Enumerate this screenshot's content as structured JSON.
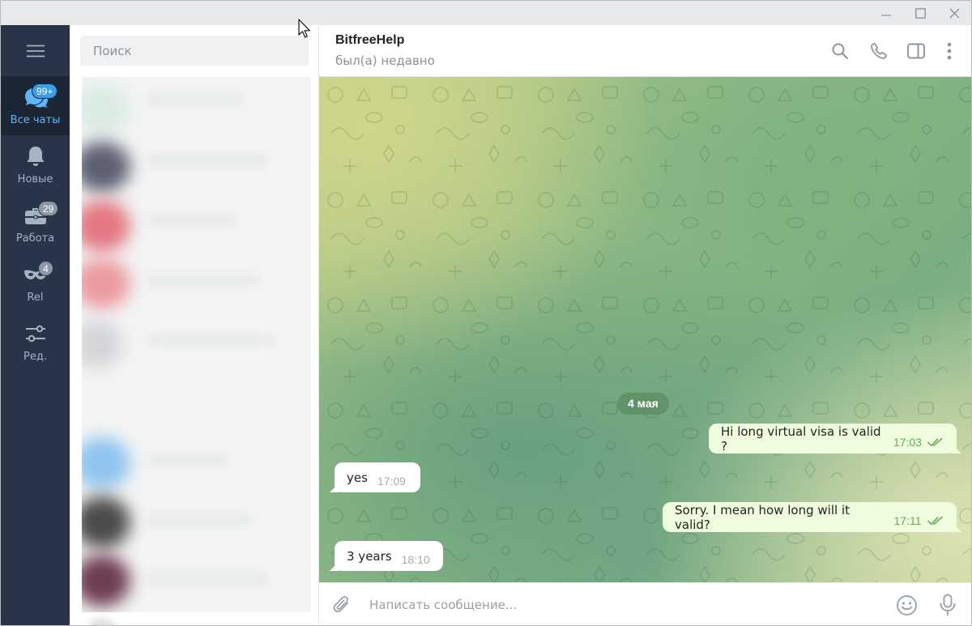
{
  "window": {
    "controls": [
      "minimize-icon",
      "maximize-icon",
      "close-icon"
    ]
  },
  "sidebar": {
    "menu_icon": "hamburger-icon",
    "folders": [
      {
        "label": "Все чаты",
        "badge": "99+",
        "icon": "chats-icon",
        "active": true
      },
      {
        "label": "Новые",
        "badge": "",
        "icon": "bell-icon",
        "active": false
      },
      {
        "label": "Работа",
        "badge": "29",
        "icon": "briefcase-icon",
        "active": false
      },
      {
        "label": "Rel",
        "badge": "4",
        "icon": "mask-icon",
        "active": false
      },
      {
        "label": "Ред.",
        "badge": "",
        "icon": "sliders-icon",
        "active": false
      }
    ]
  },
  "chatlist": {
    "search_placeholder": "Поиск"
  },
  "chat": {
    "title": "BitfreeHelp",
    "status": "был(а) недавно",
    "header_icons": [
      "search-icon",
      "phone-icon",
      "sidebar-toggle-icon",
      "more-icon"
    ],
    "date_separator": "4 мая",
    "messages": [
      {
        "direction": "out",
        "text": "Hi long virtual visa is valid ?",
        "time": "17:03",
        "read": true
      },
      {
        "direction": "in",
        "text": "yes",
        "time": "17:09"
      },
      {
        "direction": "out",
        "text": "Sorry. I mean how long will it valid?",
        "time": "17:11",
        "read": true
      },
      {
        "direction": "in",
        "text": "3 years",
        "time": "18:10"
      }
    ],
    "composer_placeholder": "Написать сообщение..."
  },
  "colors": {
    "sidebar_bg": "#283548",
    "accent": "#5eb5f7",
    "outgoing_bubble": "#effdde",
    "read_ticks": "#62ac55"
  }
}
